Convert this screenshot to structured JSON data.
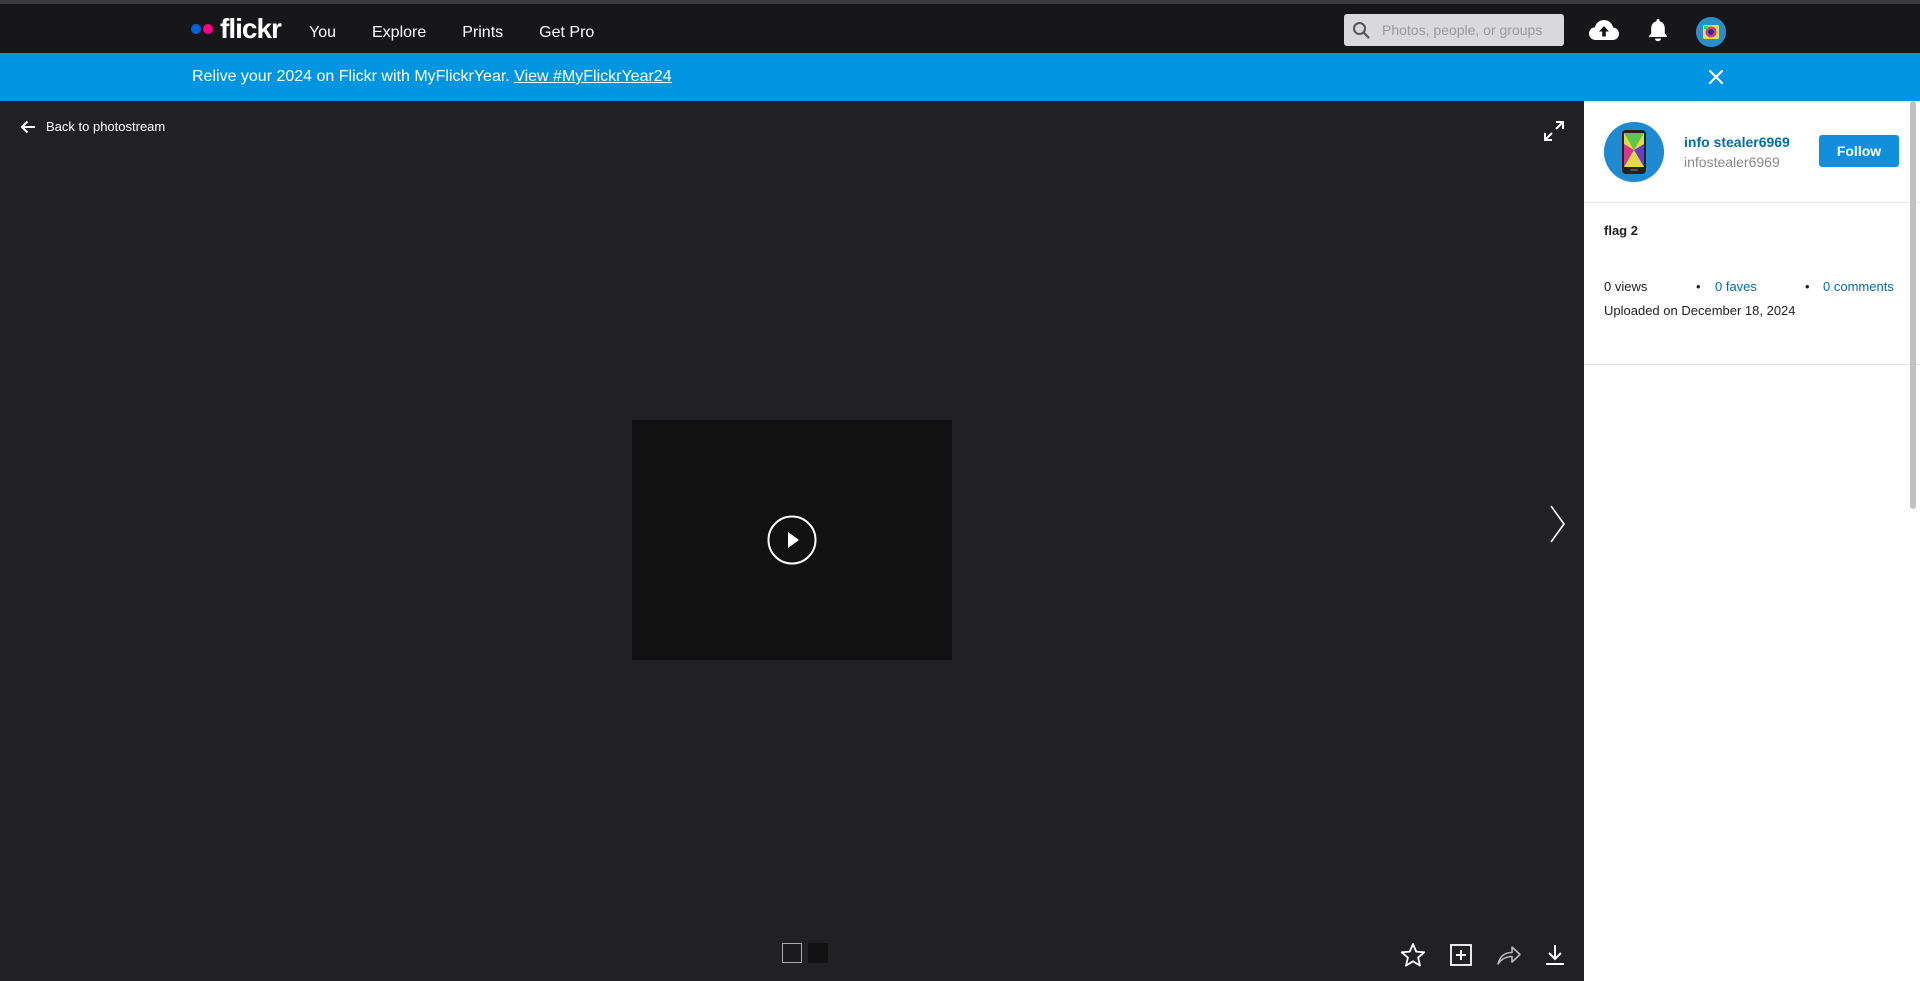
{
  "header": {
    "logo_text": "flickr",
    "nav": [
      "You",
      "Explore",
      "Prints",
      "Get Pro"
    ],
    "search_placeholder": "Photos, people, or groups",
    "icons": [
      "upload-icon",
      "notifications-icon"
    ]
  },
  "banner": {
    "text": "Relive your 2024 on Flickr with MyFlickrYear.",
    "link": "View #MyFlickrYear24"
  },
  "viewer": {
    "back_label": "Back to photostream",
    "media_type": "video"
  },
  "sidebar": {
    "owner_name": "info stealer6969",
    "owner_handle": "infostealer6969",
    "follow_label": "Follow",
    "photo_title": "flag 2",
    "views": "0 views",
    "faves": "0 faves",
    "comments": "0 comments",
    "bullet": "•",
    "uploaded": "Uploaded on December 18, 2024"
  },
  "colors": {
    "banner": "#0095e0",
    "link": "#006dac",
    "follow_button": "#128fdc",
    "viewer_bg": "#212124"
  }
}
